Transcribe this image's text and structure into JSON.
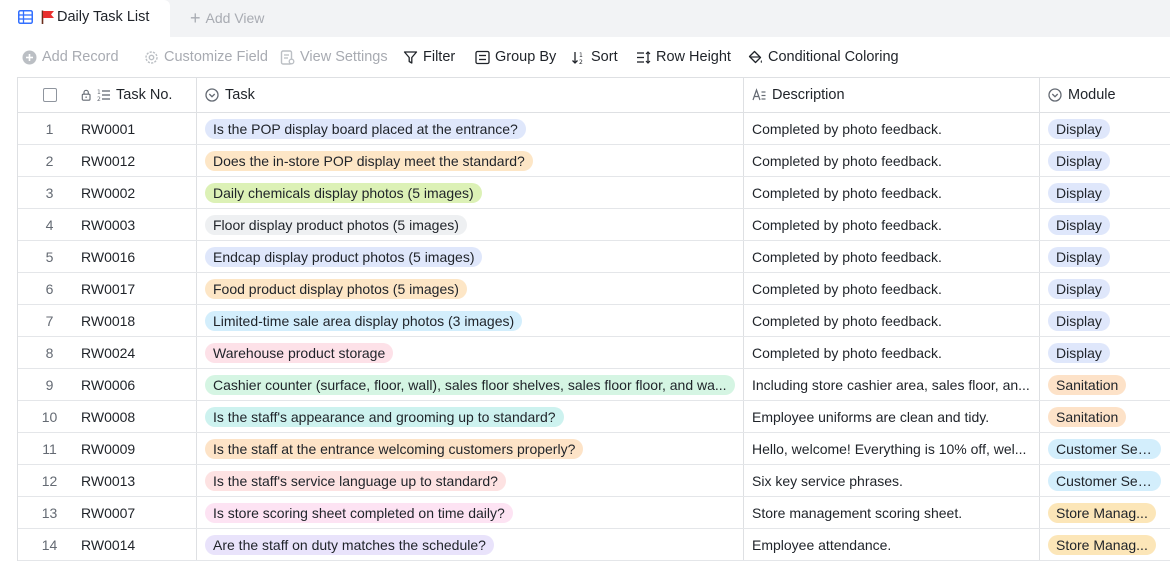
{
  "tabbar": {
    "active_tab": "Daily Task List",
    "add_view": "Add View"
  },
  "toolbar": {
    "add_record": "Add Record",
    "customize_field": "Customize Field",
    "view_settings": "View Settings",
    "filter": "Filter",
    "group_by": "Group By",
    "sort": "Sort",
    "row_height": "Row Height",
    "conditional_coloring": "Conditional Coloring"
  },
  "columns": {
    "task_no": "Task No.",
    "task": "Task",
    "description": "Description",
    "module": "Module"
  },
  "colors": {
    "blue": "#dfe7fb",
    "orange": "#fde6c6",
    "green": "#dcf1b6",
    "gray": "#eef0f2",
    "cyan": "#d3eefc",
    "pink": "#fde1e8",
    "mint": "#d5f5e3",
    "teal": "#cdf2ef",
    "peach": "#fde3c7",
    "rose": "#fde2e2",
    "magenta": "#fde3f3",
    "purple": "#e9e3fb",
    "sanitation": "#fde2c8",
    "customer": "#d3eefc",
    "store": "#fce6b8",
    "display": "#dfe7fb"
  },
  "rows": [
    {
      "n": "1",
      "no": "RW0001",
      "task": "Is the POP display board placed at the entrance?",
      "task_color": "#dfe7fb",
      "desc": "Completed by photo feedback.",
      "module": "Display",
      "module_color": "#dfe7fb"
    },
    {
      "n": "2",
      "no": "RW0012",
      "task": "Does the in-store POP display meet the standard?",
      "task_color": "#fde6c6",
      "desc": "Completed by photo feedback.",
      "module": "Display",
      "module_color": "#dfe7fb"
    },
    {
      "n": "3",
      "no": "RW0002",
      "task": "Daily chemicals display photos (5 images)",
      "task_color": "#dcf1b6",
      "desc": "Completed by photo feedback.",
      "module": "Display",
      "module_color": "#dfe7fb"
    },
    {
      "n": "4",
      "no": "RW0003",
      "task": "Floor display product photos (5 images)",
      "task_color": "#eef0f2",
      "desc": "Completed by photo feedback.",
      "module": "Display",
      "module_color": "#dfe7fb"
    },
    {
      "n": "5",
      "no": "RW0016",
      "task": "Endcap display product photos (5 images)",
      "task_color": "#dfe7fb",
      "desc": "Completed by photo feedback.",
      "module": "Display",
      "module_color": "#dfe7fb"
    },
    {
      "n": "6",
      "no": "RW0017",
      "task": "Food product display photos (5 images)",
      "task_color": "#fde6c6",
      "desc": "Completed by photo feedback.",
      "module": "Display",
      "module_color": "#dfe7fb"
    },
    {
      "n": "7",
      "no": "RW0018",
      "task": "Limited-time sale area display photos (3 images)",
      "task_color": "#d3eefc",
      "desc": "Completed by photo feedback.",
      "module": "Display",
      "module_color": "#dfe7fb"
    },
    {
      "n": "8",
      "no": "RW0024",
      "task": "Warehouse product storage",
      "task_color": "#fde1e8",
      "desc": "Completed by photo feedback.",
      "module": "Display",
      "module_color": "#dfe7fb"
    },
    {
      "n": "9",
      "no": "RW0006",
      "task": "Cashier counter (surface, floor, wall), sales floor shelves, sales floor floor, and wa...",
      "task_color": "#d5f5e3",
      "desc": "Including store cashier area, sales floor, an...",
      "module": "Sanitation",
      "module_color": "#fde2c8"
    },
    {
      "n": "10",
      "no": "RW0008",
      "task": "Is the staff's appearance and grooming up to standard?",
      "task_color": "#cdf2ef",
      "desc": "Employee uniforms are clean and tidy.",
      "module": "Sanitation",
      "module_color": "#fde2c8"
    },
    {
      "n": "11",
      "no": "RW0009",
      "task": "Is the staff at the entrance welcoming customers properly?",
      "task_color": "#fde3c7",
      "desc": "Hello, welcome! Everything is 10% off, wel...",
      "module": "Customer Ser...",
      "module_color": "#d3eefc"
    },
    {
      "n": "12",
      "no": "RW0013",
      "task": "Is the staff's service language up to standard?",
      "task_color": "#fde2e2",
      "desc": "Six key service phrases.",
      "module": "Customer Ser...",
      "module_color": "#d3eefc"
    },
    {
      "n": "13",
      "no": "RW0007",
      "task": "Is store scoring sheet completed on time daily?",
      "task_color": "#fde3f3",
      "desc": "Store management scoring sheet.",
      "module": "Store Manag...",
      "module_color": "#fce6b8"
    },
    {
      "n": "14",
      "no": "RW0014",
      "task": "Are the staff on duty matches the schedule?",
      "task_color": "#e9e3fb",
      "desc": "Employee attendance.",
      "module": "Store Manag...",
      "module_color": "#fce6b8"
    }
  ]
}
